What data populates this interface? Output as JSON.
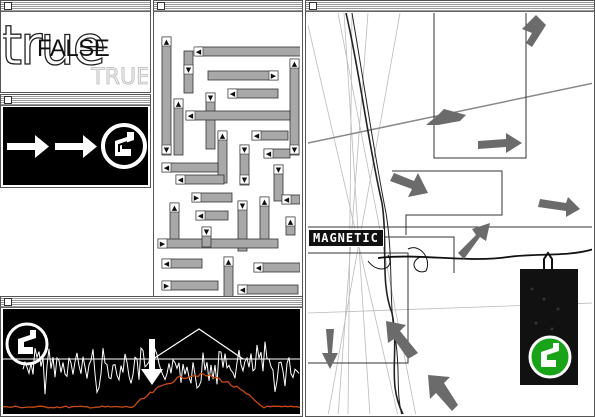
{
  "window_truefalse": {
    "bg_text": "true",
    "faint_text": "TRUE",
    "value_label": "FALSE"
  },
  "window_magnetic": {
    "label": "MAGNETIC"
  },
  "colors": {
    "gray_cell": "#a8a8a8",
    "logo_green": "#19a319",
    "signal_orange": "#c84a10",
    "arrow_gray": "#6b6b6b"
  },
  "icons": [
    "right-arrow-icon",
    "spiral-logo-icon",
    "close-box-icon",
    "down-arrow-icon"
  ]
}
